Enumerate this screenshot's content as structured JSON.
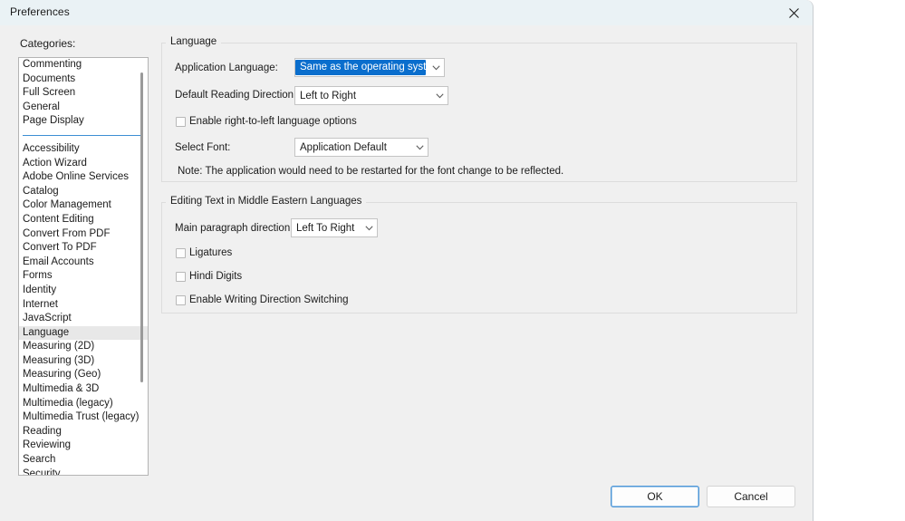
{
  "window": {
    "title": "Preferences",
    "close_icon": "close-icon"
  },
  "sidebar": {
    "label": "Categories:",
    "group_one": [
      "Commenting",
      "Documents",
      "Full Screen",
      "General",
      "Page Display"
    ],
    "group_two": [
      "Accessibility",
      "Action Wizard",
      "Adobe Online Services",
      "Catalog",
      "Color Management",
      "Content Editing",
      "Convert From PDF",
      "Convert To PDF",
      "Email Accounts",
      "Forms",
      "Identity",
      "Internet",
      "JavaScript",
      "Language",
      "Measuring (2D)",
      "Measuring (3D)",
      "Measuring (Geo)",
      "Multimedia & 3D",
      "Multimedia (legacy)",
      "Multimedia Trust (legacy)",
      "Reading",
      "Reviewing",
      "Search",
      "Security"
    ],
    "selected": "Language",
    "separator_color": "#3d8fd4"
  },
  "language_group": {
    "title": "Language",
    "application_language": {
      "label": "Application Language:",
      "value": "Same as the operating system",
      "highlight_color": "#0a6ecd"
    },
    "default_reading_direction": {
      "label": "Default Reading Direction:",
      "value": "Left to Right"
    },
    "rtl_checkbox": {
      "label": "Enable right-to-left language options",
      "checked": false
    },
    "select_font": {
      "label": "Select Font:",
      "value": "Application Default"
    },
    "note": "Note: The application would need to be restarted for the font change to be reflected."
  },
  "middle_east_group": {
    "title": "Editing Text in Middle Eastern Languages",
    "main_paragraph_direction": {
      "label": "Main paragraph direction:",
      "value": "Left To Right"
    },
    "checkboxes": [
      {
        "label": "Ligatures",
        "checked": false
      },
      {
        "label": "Hindi Digits",
        "checked": false
      },
      {
        "label": "Enable Writing Direction Switching",
        "checked": false
      }
    ]
  },
  "footer": {
    "ok_label": "OK",
    "cancel_label": "Cancel"
  }
}
